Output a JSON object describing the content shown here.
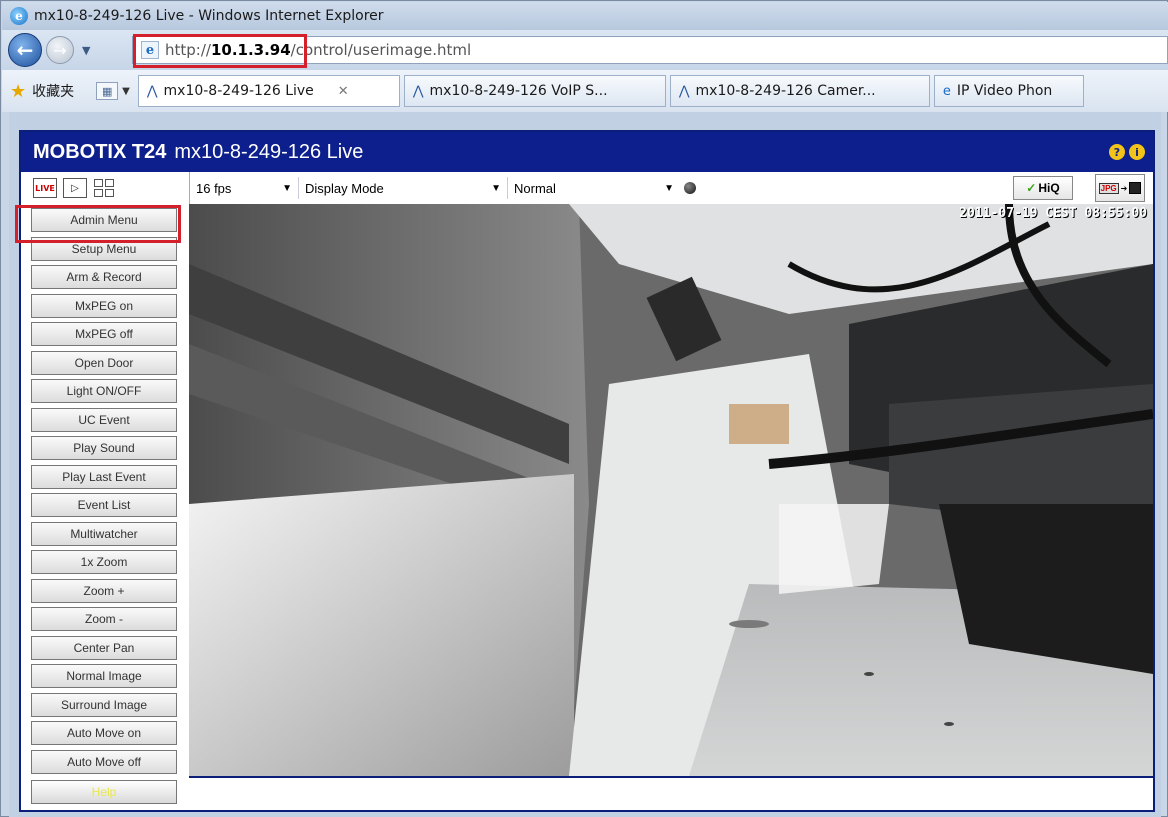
{
  "window": {
    "title": "mx10-8-249-126 Live - Windows Internet Explorer"
  },
  "nav": {
    "address_prefix": "http://",
    "address_host": "10.1.3.94",
    "address_path": "/control/userimage.html"
  },
  "tabbar": {
    "favorites_label": "收藏夹",
    "tabs": [
      {
        "label": "mx10-8-249-126 Live",
        "active": true
      },
      {
        "label": "mx10-8-249-126 VoIP S...",
        "active": false
      },
      {
        "label": "mx10-8-249-126 Camer...",
        "active": false
      },
      {
        "label": "IP Video Phon",
        "active": false
      }
    ]
  },
  "header": {
    "brand": "MOBOTIX T24",
    "title": "mx10-8-249-126 Live"
  },
  "mode_buttons": {
    "live": "LIVE"
  },
  "toolbar": {
    "fps": "16 fps",
    "display_mode": "Display Mode",
    "image_mode": "Normal",
    "hiq": "HiQ",
    "jpg": "JPG"
  },
  "live": {
    "timestamp": "2011-07-19 CEST 08:55:00"
  },
  "sidebar": {
    "buttons": [
      "Admin Menu",
      "Setup Menu",
      "Arm & Record",
      "MxPEG on",
      "MxPEG off",
      "Open Door",
      "Light ON/OFF",
      "UC Event",
      "Play Sound",
      "Play Last Event",
      "Event List",
      "Multiwatcher",
      "1x Zoom",
      "Zoom +",
      "Zoom -",
      "Center Pan",
      "Normal Image",
      "Surround Image",
      "Auto Move on",
      "Auto Move off"
    ],
    "help": "Help"
  },
  "colors": {
    "header_bg": "#0d1f8c",
    "highlight": "#d4202a"
  }
}
